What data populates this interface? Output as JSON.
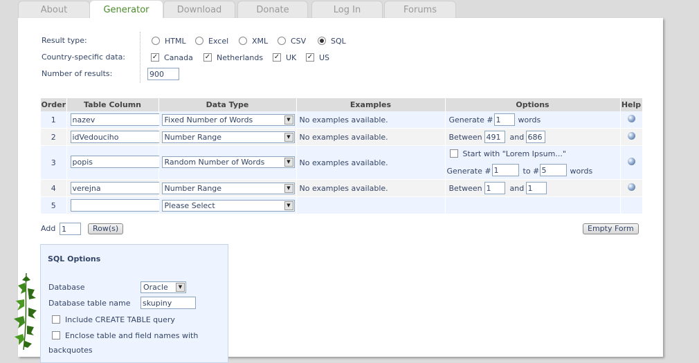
{
  "tabs": [
    "About",
    "Generator",
    "Download",
    "Donate",
    "Log In",
    "Forums"
  ],
  "active_tab": "Generator",
  "settings": {
    "result_type_label": "Result type:",
    "result_types": [
      "HTML",
      "Excel",
      "XML",
      "CSV",
      "SQL"
    ],
    "result_type_selected": "SQL",
    "country_label": "Country-specific data:",
    "countries": [
      "Canada",
      "Netherlands",
      "UK",
      "US"
    ],
    "num_results_label": "Number of results:",
    "num_results_value": "900"
  },
  "table": {
    "headers": [
      "Order",
      "Table Column",
      "Data Type",
      "Examples",
      "Options",
      "Help"
    ],
    "no_examples": "No examples available.",
    "rows": [
      {
        "order": "1",
        "column": "nazev",
        "type": "Fixed Number of Words",
        "examples": "No examples available.",
        "opt_prefix": "Generate #",
        "opt_val1": "1",
        "opt_suffix": "words"
      },
      {
        "order": "2",
        "column": "idVedouciho",
        "type": "Number Range",
        "examples": "No examples available.",
        "opt_prefix": "Between",
        "opt_val1": "491",
        "opt_mid": "and",
        "opt_val2": "686"
      },
      {
        "order": "3",
        "column": "popis",
        "type": "Random Number of Words",
        "examples": "No examples available.",
        "opt_check": "Start with \"Lorem Ipsum...\"",
        "opt_prefix": "Generate #",
        "opt_val1": "1",
        "opt_mid": "to #",
        "opt_val2": "5",
        "opt_suffix": "words"
      },
      {
        "order": "4",
        "column": "verejna",
        "type": "Number Range",
        "examples": "No examples available.",
        "opt_prefix": "Between",
        "opt_val1": "1",
        "opt_mid": "and",
        "opt_val2": "1"
      },
      {
        "order": "5",
        "column": "",
        "type": "Please Select"
      }
    ]
  },
  "add": {
    "label": "Add",
    "value": "1",
    "button": "Row(s)"
  },
  "empty_form_button": "Empty Form",
  "sql_options": {
    "title": "SQL Options",
    "database_label": "Database",
    "database_value": "Oracle",
    "table_name_label": "Database table name",
    "table_name_value": "skupiny",
    "include_create": "Include CREATE TABLE query",
    "enclose_line1": "Enclose table and field names with",
    "enclose_line2": "backquotes"
  },
  "colors": {
    "active_tab": "#4a8a2a",
    "label": "#334466",
    "row_odd": "#eef4ff",
    "row_even": "#f3f3f3",
    "header": "#dddddd"
  }
}
